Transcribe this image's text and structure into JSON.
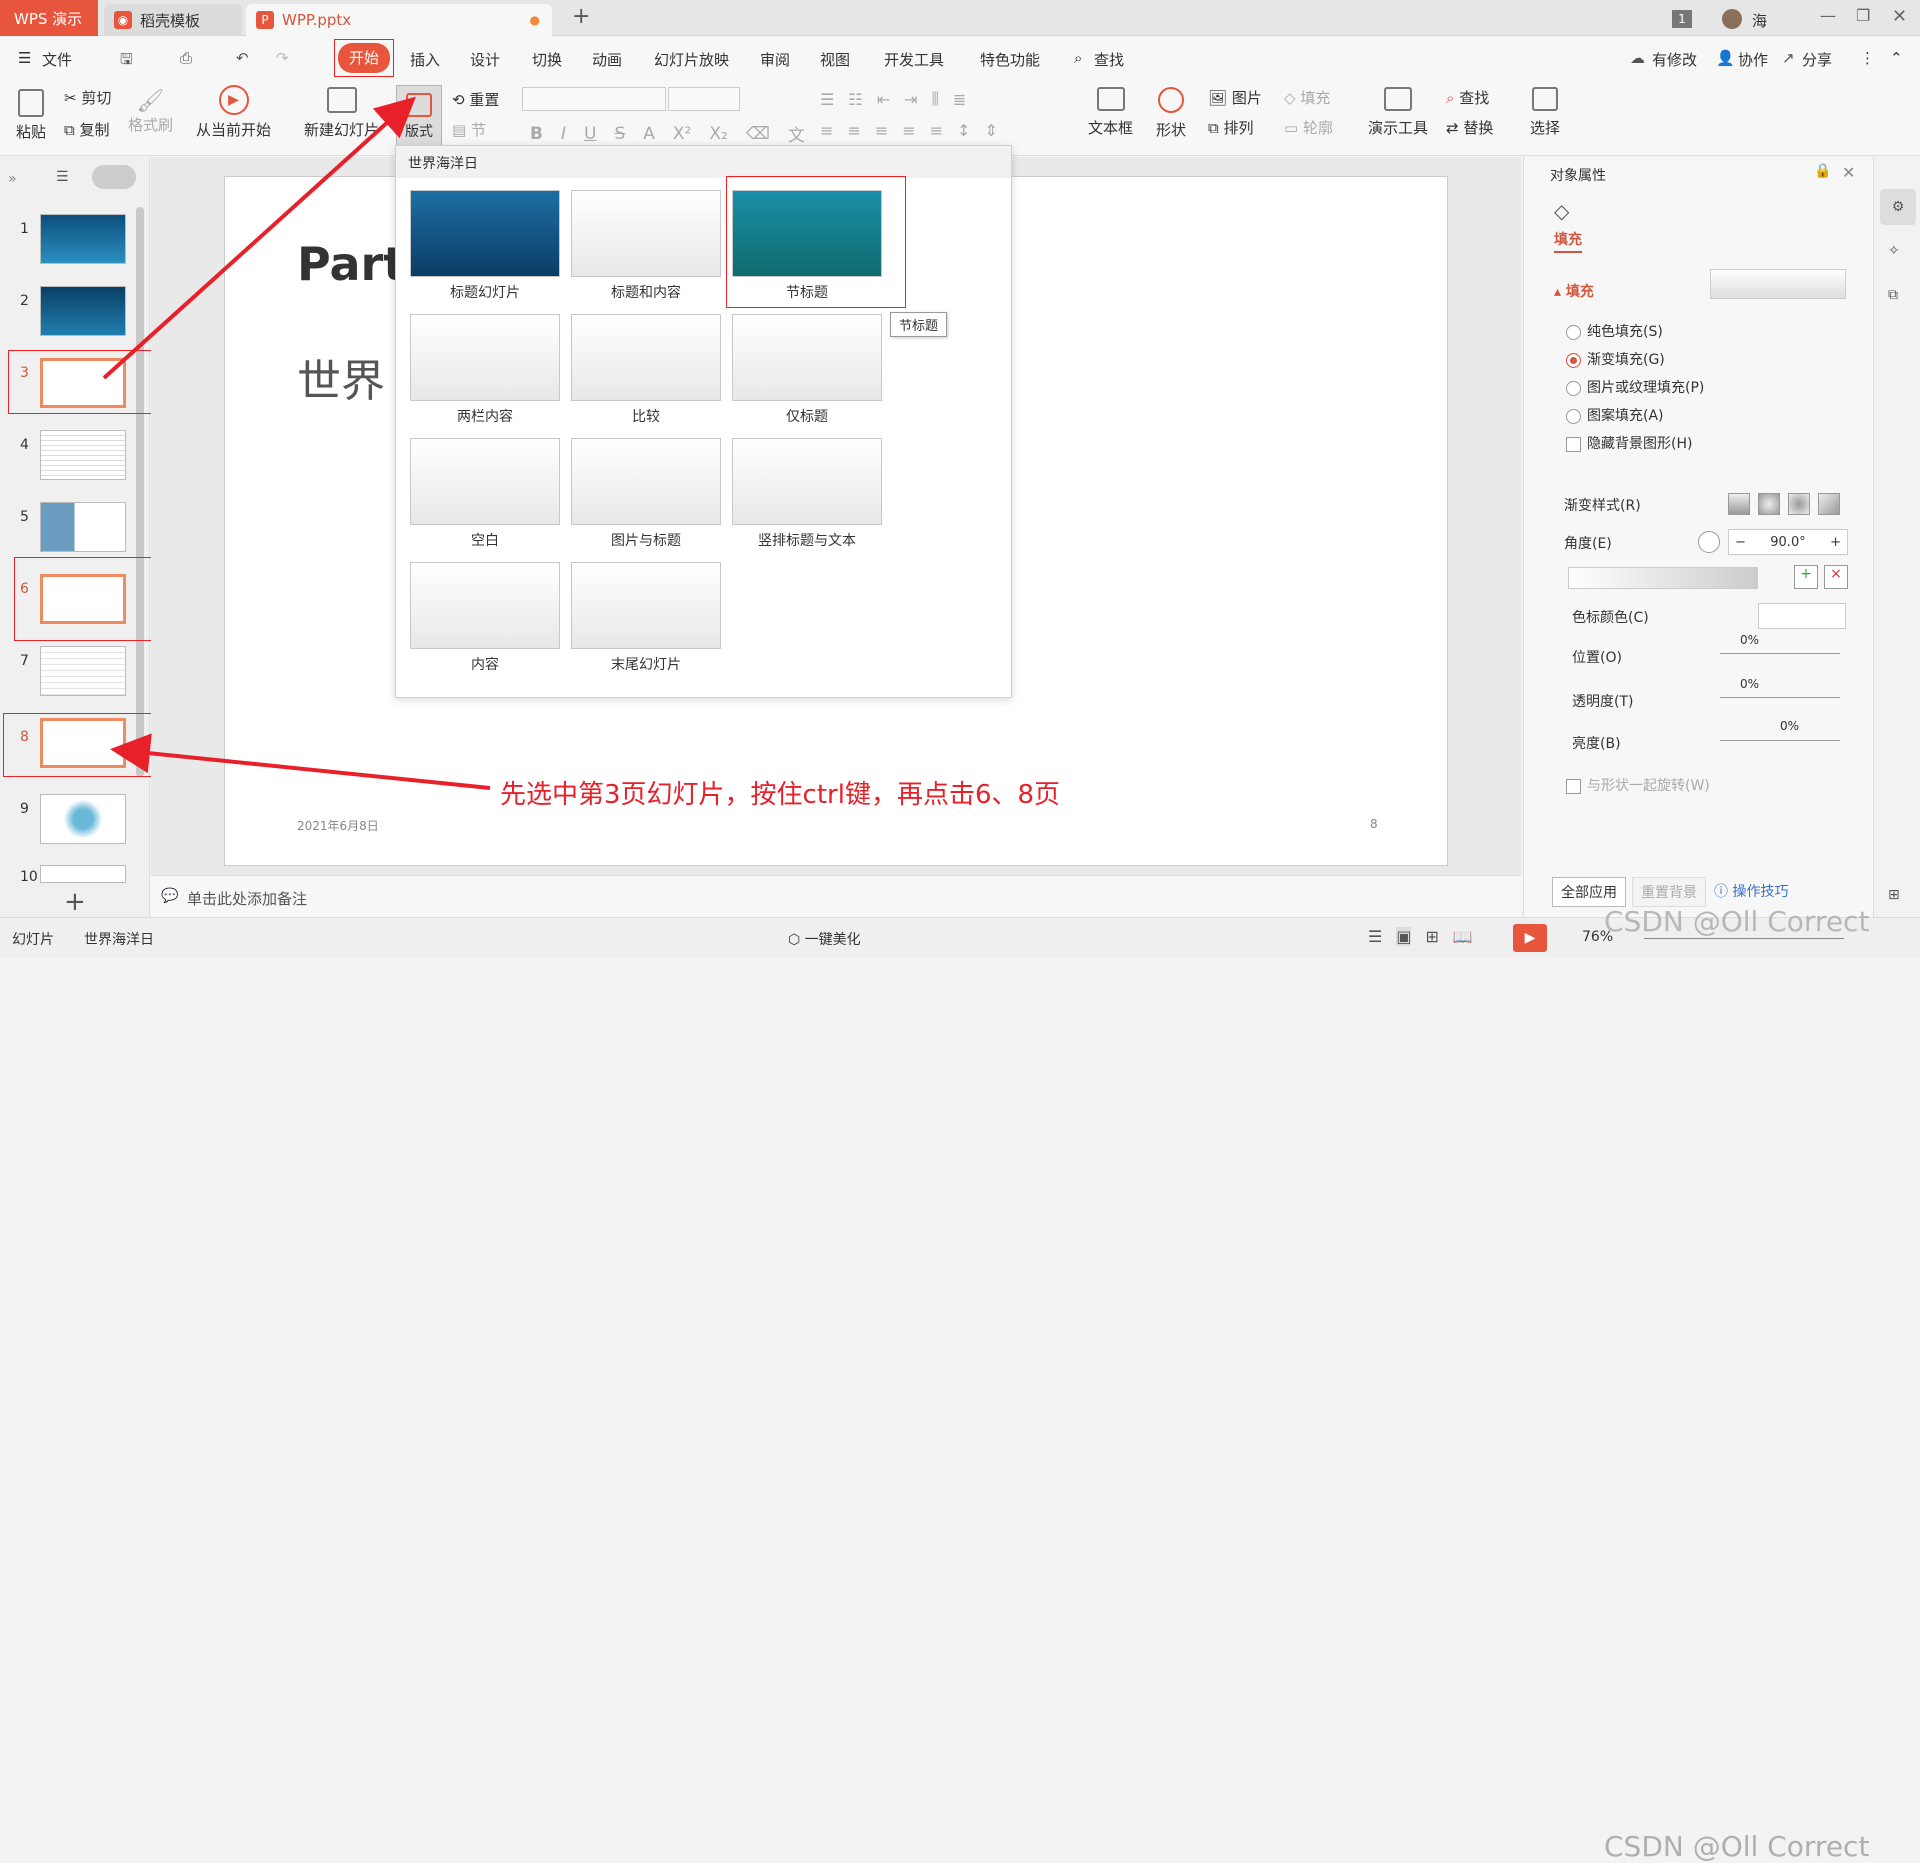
{
  "titlebar": {
    "tabs": [
      {
        "label": "WPS 演示"
      },
      {
        "label": "稻壳模板"
      },
      {
        "label": "WPP.pptx"
      }
    ],
    "user_count": "1",
    "user_name": "海"
  },
  "menu": {
    "file": "文件",
    "items": [
      "开始",
      "插入",
      "设计",
      "切换",
      "动画",
      "幻灯片放映",
      "审阅",
      "视图",
      "开发工具",
      "特色功能"
    ],
    "search": "查找",
    "right": [
      "有修改",
      "协作",
      "分享"
    ]
  },
  "ribbon": {
    "paste": "粘贴",
    "cut": "剪切",
    "copy": "复制",
    "format_painter": "格式刷",
    "from_current": "从当前开始",
    "new_slide": "新建幻灯片",
    "layout": "版式",
    "reset": "重置",
    "section": "节",
    "textbox": "文本框",
    "shape": "形状",
    "picture": "图片",
    "arrange": "排列",
    "fill": "填充",
    "outline": "轮廓",
    "presenter_tools": "演示工具",
    "find": "查找",
    "replace": "替换",
    "select": "选择"
  },
  "slides": [
    "1",
    "2",
    "3",
    "4",
    "5",
    "6",
    "7",
    "8",
    "9",
    "10"
  ],
  "slide": {
    "title": "Part",
    "subtitle": "世界",
    "date": "2021年6月8日",
    "page": "8"
  },
  "layout_menu": {
    "header": "世界海洋日",
    "layouts": [
      "标题幻灯片",
      "标题和内容",
      "节标题",
      "两栏内容",
      "比较",
      "仅标题",
      "空白",
      "图片与标题",
      "竖排标题与文本",
      "内容",
      "末尾幻灯片"
    ],
    "tooltip": "节标题"
  },
  "annotation": {
    "text": "先选中第3页幻灯片，按住ctrl键，再点击6、8页",
    "color": "#e8202a"
  },
  "right_panel": {
    "title": "对象属性",
    "tab": "填充",
    "section": "填充",
    "options": [
      "纯色填充(S)",
      "渐变填充(G)",
      "图片或纹理填充(P)",
      "图案填充(A)"
    ],
    "hide_bg": "隐藏背景图形(H)",
    "gradient_style": "渐变样式(R)",
    "angle_label": "角度(E)",
    "angle_value": "90.0°",
    "stop_color": "色标颜色(C)",
    "position": "位置(O)",
    "position_value": "0%",
    "transparency": "透明度(T)",
    "transparency_value": "0%",
    "brightness": "亮度(B)",
    "brightness_value": "0%",
    "rotate_with_shape": "与形状一起旋转(W)",
    "apply_all": "全部应用",
    "reset_bg": "重置背景",
    "tips": "操作技巧"
  },
  "notes": {
    "placeholder": "单击此处添加备注"
  },
  "status": {
    "mode": "幻灯片",
    "theme": "世界海洋日",
    "beautify": "一键美化",
    "zoom": "76%",
    "watermark": "CSDN @Oll Correct"
  },
  "colors": {
    "accent": "#d4553d",
    "red": "#e8202a"
  }
}
